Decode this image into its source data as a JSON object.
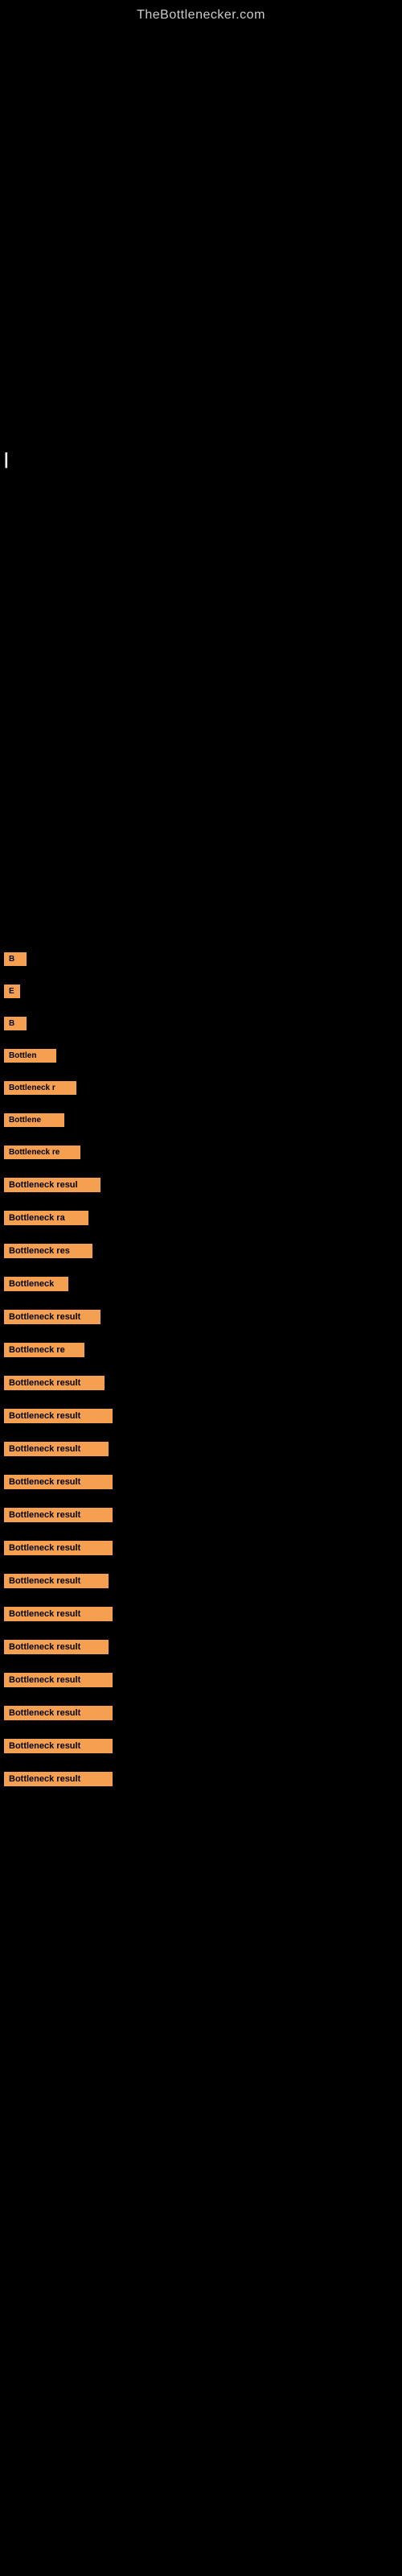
{
  "site": {
    "title": "TheBottlenecker.com"
  },
  "results": [
    {
      "id": 1,
      "label": "B",
      "widthClass": "badge-w1"
    },
    {
      "id": 2,
      "label": "E",
      "widthClass": "badge-w2"
    },
    {
      "id": 3,
      "label": "B",
      "widthClass": "badge-w3"
    },
    {
      "id": 4,
      "label": "Bottlen",
      "widthClass": "badge-w4"
    },
    {
      "id": 5,
      "label": "Bottleneck r",
      "widthClass": "badge-w5"
    },
    {
      "id": 6,
      "label": "Bottlene",
      "widthClass": "badge-w6"
    },
    {
      "id": 7,
      "label": "Bottleneck re",
      "widthClass": "badge-w7"
    },
    {
      "id": 8,
      "label": "Bottleneck resul",
      "widthClass": "badge-w8"
    },
    {
      "id": 9,
      "label": "Bottleneck ra",
      "widthClass": "badge-w9"
    },
    {
      "id": 10,
      "label": "Bottleneck res",
      "widthClass": "badge-w10"
    },
    {
      "id": 11,
      "label": "Bottleneck",
      "widthClass": "badge-w11"
    },
    {
      "id": 12,
      "label": "Bottleneck result",
      "widthClass": "badge-w12"
    },
    {
      "id": 13,
      "label": "Bottleneck re",
      "widthClass": "badge-w13"
    },
    {
      "id": 14,
      "label": "Bottleneck result",
      "widthClass": "badge-w14"
    },
    {
      "id": 15,
      "label": "Bottleneck result",
      "widthClass": "badge-w15"
    },
    {
      "id": 16,
      "label": "Bottleneck result",
      "widthClass": "badge-w16"
    },
    {
      "id": 17,
      "label": "Bottleneck result",
      "widthClass": "badge-w17"
    },
    {
      "id": 18,
      "label": "Bottleneck result",
      "widthClass": "badge-w18"
    },
    {
      "id": 19,
      "label": "Bottleneck result",
      "widthClass": "badge-w19"
    },
    {
      "id": 20,
      "label": "Bottleneck result",
      "widthClass": "badge-w20"
    },
    {
      "id": 21,
      "label": "Bottleneck result",
      "widthClass": "badge-w21"
    },
    {
      "id": 22,
      "label": "Bottleneck result",
      "widthClass": "badge-w22"
    },
    {
      "id": 23,
      "label": "Bottleneck result",
      "widthClass": "badge-w23"
    },
    {
      "id": 24,
      "label": "Bottleneck result",
      "widthClass": "badge-w24"
    },
    {
      "id": 25,
      "label": "Bottleneck result",
      "widthClass": "badge-w25"
    },
    {
      "id": 26,
      "label": "Bottleneck result",
      "widthClass": "badge-w26"
    }
  ]
}
